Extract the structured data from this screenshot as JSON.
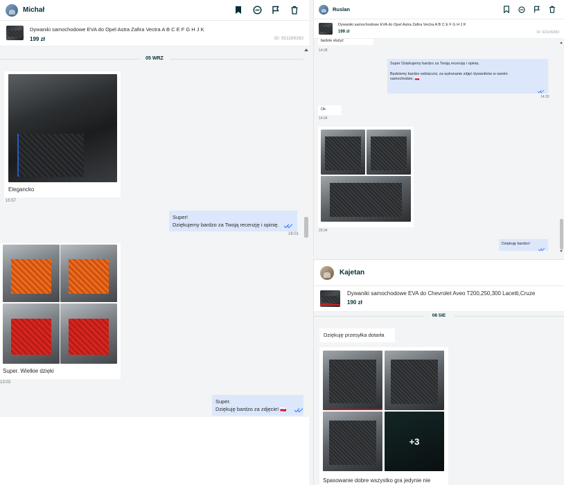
{
  "conversation_1": {
    "user": "Michał",
    "product": {
      "title": "Dywaniki samochodowe EVA do Opel Astra Zafira Vectra A B C E F G H J K",
      "price": "199 zł",
      "id": "ID: 921189283"
    },
    "date": "05 WRZ",
    "messages": [
      {
        "text": "Elegancko",
        "time": "15:57"
      },
      {
        "text1": "Super!",
        "text2": "Dziękujemy bardzo za Twoją recenzję i opinię.",
        "time": "16:01"
      },
      {
        "text": "Super. Wielkie dzięki",
        "time": "13:03"
      },
      {
        "text1": "Super.",
        "text2": "Dziękuję bardzo za zdjęcie! 🇵🇱"
      }
    ]
  },
  "conversation_2": {
    "user": "Ruslan",
    "product": {
      "title": "Dywaniki samochodowe EVA do Opel Astra Zafira Vectra A B C E F G H J K",
      "price": "199 zł",
      "id": "ID: 921189283"
    },
    "messages": [
      {
        "text": "będzie służyć",
        "time": "14:28"
      },
      {
        "text1": "Super Dziękujemy bardzo za Twoją recenzję i opinię.",
        "text2": "Będziemy bardzo wdzięczni, za wykonanie zdjęć dywaników w swoim samochodzie. 🇵🇱",
        "time": "14:33"
      },
      {
        "text": "Ok",
        "time": "14:34"
      },
      {
        "time": "20:34"
      },
      {
        "text": "Dziękuję bardzo!"
      }
    ]
  },
  "conversation_3": {
    "user": "Kajetan",
    "product": {
      "title": "Dywaniki samochodowe EVA do Chevrolet Aveo T200,250,300 Lacetti,Cruze",
      "price": "190 zł"
    },
    "date": "08 SIE",
    "messages": [
      {
        "text": "Dziękuję przesyłka dotarła"
      },
      {
        "more": "+3"
      },
      {
        "text": "Spasowanie dobre wszystko gra jedynie nie"
      }
    ]
  },
  "icons": [
    "bookmark-icon",
    "block-icon",
    "flag-icon",
    "trash-icon",
    "double-check-icon"
  ],
  "colors": {
    "own_bubble": "#dce7fb",
    "feed_bg": "#f2f4f5",
    "heading": "#002f34",
    "check": "#3a77ff"
  }
}
